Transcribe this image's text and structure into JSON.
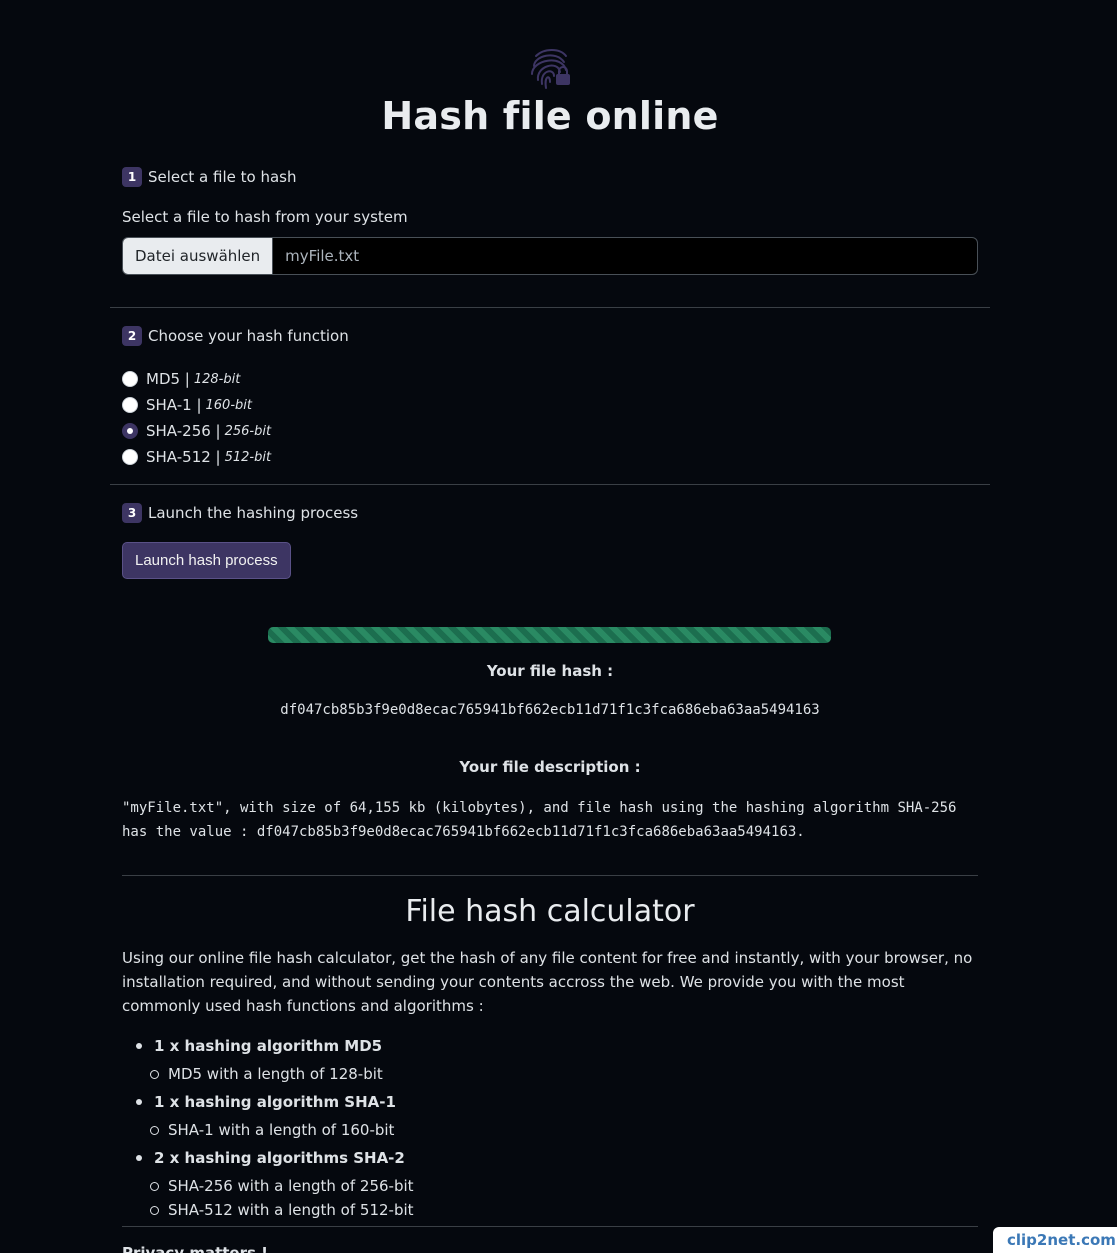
{
  "header": {
    "logo_icon": "fingerprint-lock-icon",
    "title": "Hash file online"
  },
  "step1": {
    "number": "1",
    "label": "Select a file to hash",
    "field_label": "Select a file to hash from your system",
    "choose_button": "Datei auswählen",
    "file_name": "myFile.txt"
  },
  "step2": {
    "number": "2",
    "label": "Choose your hash function",
    "options": [
      {
        "name": "MD5 |",
        "bits": "128-bit",
        "checked": false
      },
      {
        "name": "SHA-1 |",
        "bits": "160-bit",
        "checked": false
      },
      {
        "name": "SHA-256 |",
        "bits": "256-bit",
        "checked": true
      },
      {
        "name": "SHA-512 |",
        "bits": "512-bit",
        "checked": false
      }
    ]
  },
  "step3": {
    "number": "3",
    "label": "Launch the hashing process",
    "button": "Launch hash process"
  },
  "progress": {
    "percent": 100,
    "color": "#2a8a63"
  },
  "result": {
    "hash_title": "Your file hash :",
    "hash_value": "df047cb85b3f9e0d8ecac765941bf662ecb11d71f1c3fca686eba63aa5494163",
    "desc_title": "Your file description :",
    "desc_body": "\"myFile.txt\", with size of 64,155 kb (kilobytes), and file hash using the hashing algorithm SHA-256 has the value : df047cb85b3f9e0d8ecac765941bf662ecb11d71f1c3fca686eba63aa5494163."
  },
  "calculator": {
    "title": "File hash calculator",
    "intro": "Using our online file hash calculator, get the hash of any file content for free and instantly, with your browser, no installation required, and without sending your contents accross the web. We provide you with the most commonly used hash functions and algorithms :",
    "groups": [
      {
        "title": "1 x hashing algorithm MD5",
        "items": [
          "MD5 with a length of 128-bit"
        ]
      },
      {
        "title": "1 x hashing algorithm SHA-1",
        "items": [
          "SHA-1 with a length of 160-bit"
        ]
      },
      {
        "title": "2 x hashing algorithms SHA-2",
        "items": [
          "SHA-256 with a length of 256-bit",
          "SHA-512 with a length of 512-bit"
        ]
      }
    ],
    "next_heading": "Privacy matters !"
  },
  "watermark": "clip2net.com",
  "colors": {
    "background": "#05080e",
    "accent": "#3d3563",
    "progress": "#2a8a63"
  }
}
